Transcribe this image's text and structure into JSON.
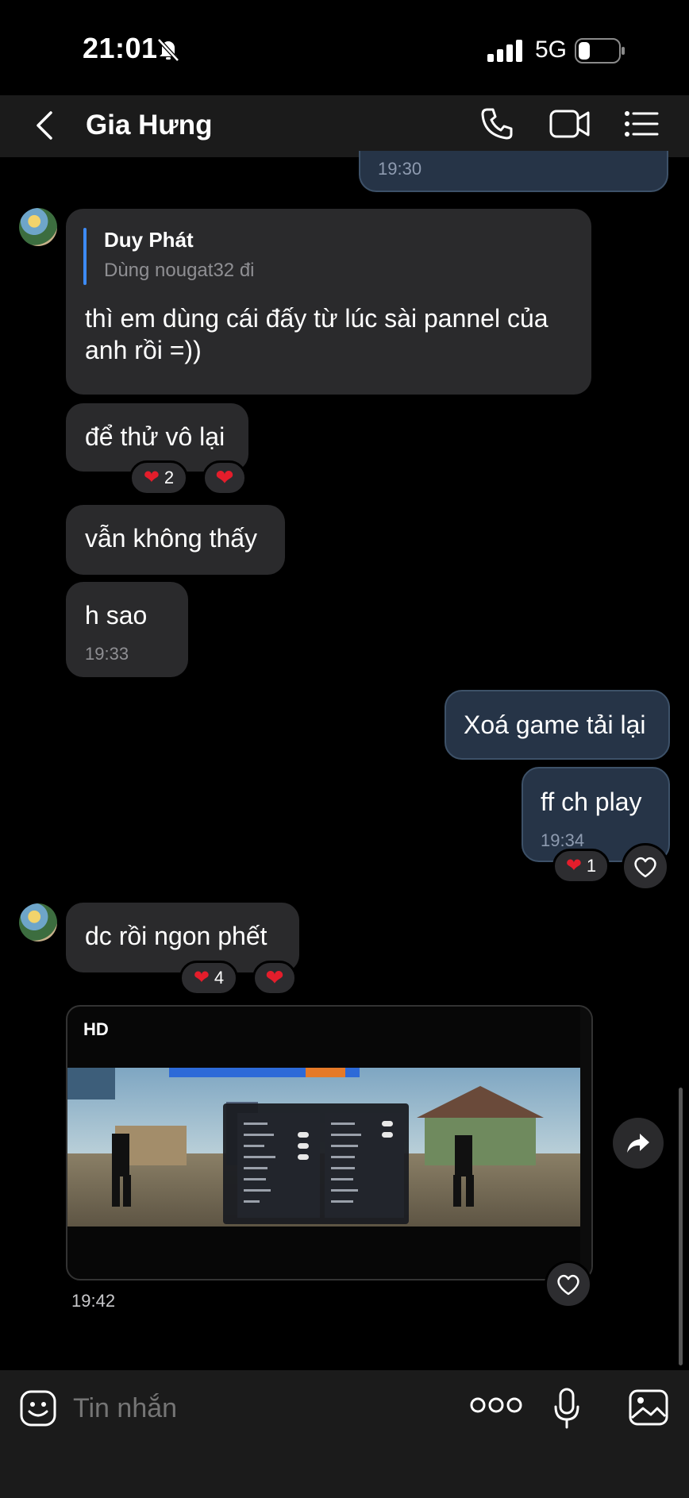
{
  "status": {
    "time": "21:01",
    "network": "5G"
  },
  "header": {
    "title": "Gia Hưng"
  },
  "messages": {
    "m0_time": "19:30",
    "m1": {
      "quote_author": "Duy Phát",
      "quote_text": "Dùng nougat32 đi",
      "text_line1": "thì em dùng cái đấy từ lúc sài pannel của",
      "text_line2": "anh rồi =))"
    },
    "m2": {
      "text": "để thử vô lại",
      "reaction_count": "2"
    },
    "m3": {
      "text": "vẫn không thấy"
    },
    "m4": {
      "text": "h sao",
      "time": "19:33"
    },
    "m5": {
      "text": "Xoá game tải lại"
    },
    "m6": {
      "text": "ff ch play",
      "time": "19:34",
      "reaction_count": "1"
    },
    "m7": {
      "text": "dc rồi ngon phết",
      "reaction_count": "4"
    },
    "m8": {
      "badge": "HD",
      "time": "19:42"
    }
  },
  "input": {
    "placeholder": "Tin nhắn"
  },
  "colors": {
    "heart": "#e41d2b",
    "outgoing_bubble": "#263447",
    "incoming_bubble": "#2a2a2c",
    "header_bg": "#1b1b1b"
  },
  "icons": [
    "bell-off-icon",
    "signal-icon",
    "battery-icon",
    "back-arrow-icon",
    "phone-icon",
    "video-icon",
    "menu-list-icon",
    "heart-icon",
    "forward-icon",
    "emoji-icon",
    "more-icon",
    "mic-icon",
    "image-icon"
  ]
}
